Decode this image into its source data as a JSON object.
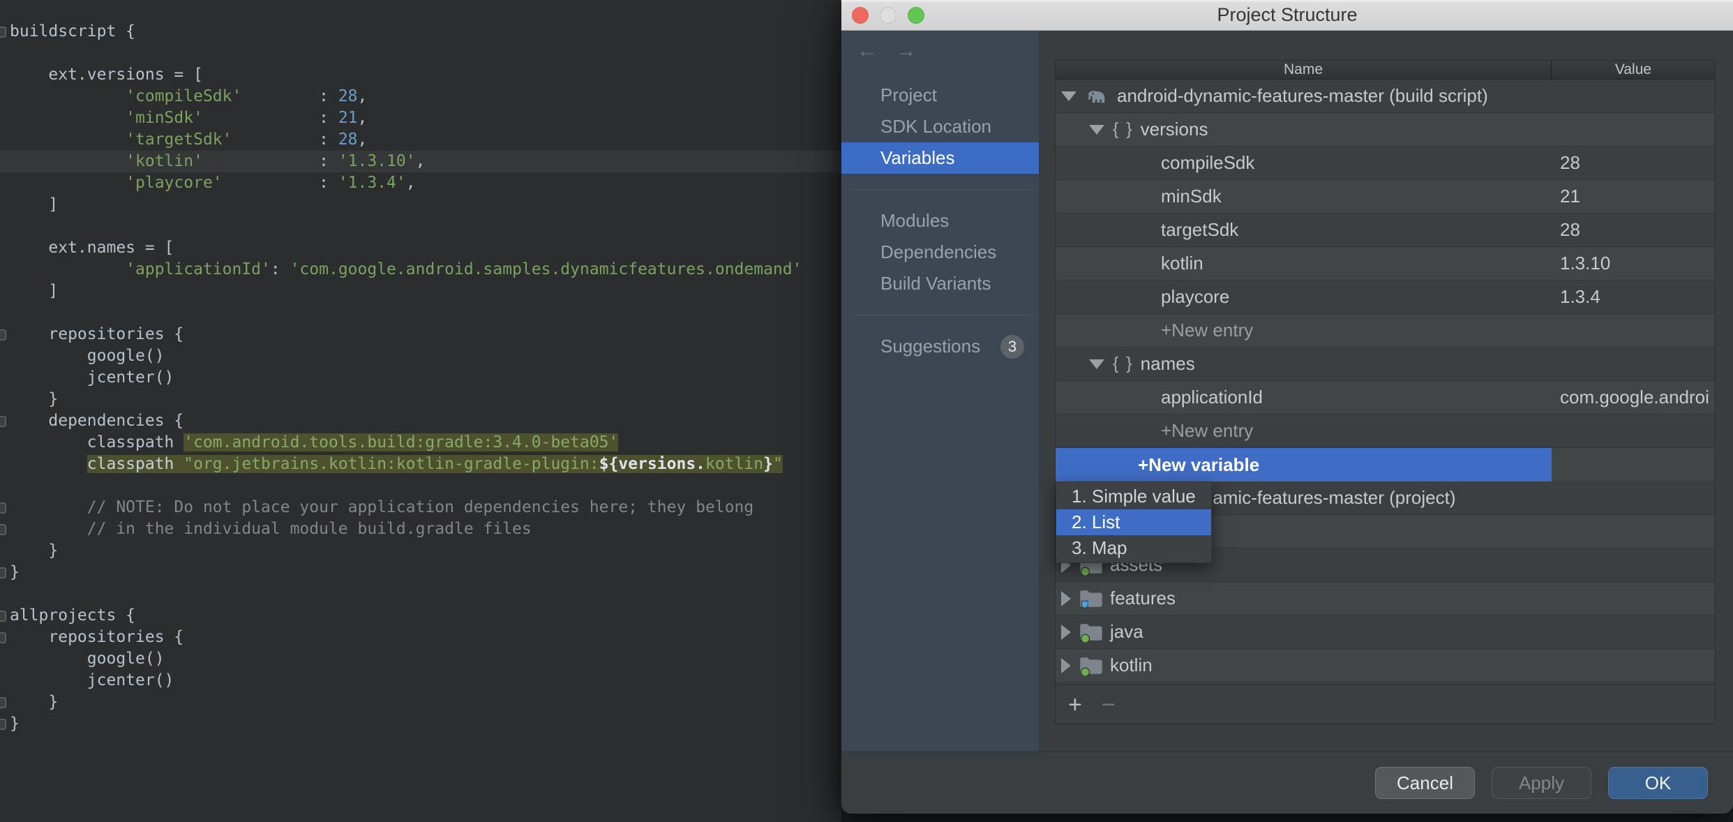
{
  "editor": {
    "lines": [
      {
        "mark": true,
        "segs": [
          [
            "p",
            "buildscript {"
          ]
        ]
      },
      {
        "segs": []
      },
      {
        "segs": [
          [
            "p",
            "    ext.versions = ["
          ]
        ]
      },
      {
        "segs": [
          [
            "s",
            "            'compileSdk'"
          ],
          [
            "p",
            "        : "
          ],
          [
            "n",
            "28"
          ],
          [
            "p",
            ","
          ]
        ]
      },
      {
        "segs": [
          [
            "s",
            "            'minSdk'"
          ],
          [
            "p",
            "            : "
          ],
          [
            "n",
            "21"
          ],
          [
            "p",
            ","
          ]
        ]
      },
      {
        "segs": [
          [
            "s",
            "            'targetSdk'"
          ],
          [
            "p",
            "         : "
          ],
          [
            "n",
            "28"
          ],
          [
            "p",
            ","
          ]
        ]
      },
      {
        "cur": true,
        "segs": [
          [
            "s",
            "            'kotlin'"
          ],
          [
            "p",
            "            : "
          ],
          [
            "s",
            "'1.3.10'"
          ],
          [
            "p",
            ","
          ]
        ]
      },
      {
        "segs": [
          [
            "s",
            "            'playcore'"
          ],
          [
            "p",
            "          : "
          ],
          [
            "s",
            "'1.3.4'"
          ],
          [
            "p",
            ","
          ]
        ]
      },
      {
        "segs": [
          [
            "p",
            "    ]"
          ]
        ]
      },
      {
        "segs": []
      },
      {
        "segs": [
          [
            "p",
            "    ext.names = ["
          ]
        ]
      },
      {
        "segs": [
          [
            "s",
            "            'applicationId'"
          ],
          [
            "p",
            ": "
          ],
          [
            "s",
            "'com.google.android.samples.dynamicfeatures.ondemand'"
          ]
        ]
      },
      {
        "segs": [
          [
            "p",
            "    ]"
          ]
        ]
      },
      {
        "segs": []
      },
      {
        "mark": true,
        "segs": [
          [
            "p",
            "    repositories {"
          ]
        ]
      },
      {
        "segs": [
          [
            "p",
            "        google()"
          ]
        ]
      },
      {
        "segs": [
          [
            "p",
            "        jcenter()"
          ]
        ]
      },
      {
        "segs": [
          [
            "p",
            "    }"
          ]
        ]
      },
      {
        "mark": true,
        "segs": [
          [
            "p",
            "    dependencies {"
          ]
        ]
      },
      {
        "segs": [
          [
            "p",
            "        classpath "
          ],
          [
            "sh",
            "'com.android.tools.build:gradle:3.4.0-beta05'"
          ]
        ]
      },
      {
        "segs": [
          [
            "p",
            "        "
          ],
          [
            "ph",
            "classpath "
          ],
          [
            "sh",
            "\"org.jetbrains.kotlin:kotlin-gradle-plugin:"
          ],
          [
            "wh",
            "${versions."
          ],
          [
            "sh",
            "kotlin"
          ],
          [
            "wh",
            "}"
          ],
          [
            "sh",
            "\""
          ]
        ]
      },
      {
        "segs": []
      },
      {
        "mark": true,
        "segs": [
          [
            "c",
            "        // NOTE: Do not place your application dependencies here; they belong"
          ]
        ]
      },
      {
        "mark": true,
        "segs": [
          [
            "c",
            "        // in the individual module build.gradle files"
          ]
        ]
      },
      {
        "segs": [
          [
            "p",
            "    }"
          ]
        ]
      },
      {
        "mark": true,
        "segs": [
          [
            "p",
            "}"
          ]
        ]
      },
      {
        "segs": []
      },
      {
        "mark": true,
        "segs": [
          [
            "p",
            "allprojects {"
          ]
        ]
      },
      {
        "mark": true,
        "segs": [
          [
            "p",
            "    repositories {"
          ]
        ]
      },
      {
        "segs": [
          [
            "p",
            "        google()"
          ]
        ]
      },
      {
        "segs": [
          [
            "p",
            "        jcenter()"
          ]
        ]
      },
      {
        "mark": true,
        "segs": [
          [
            "p",
            "    }"
          ]
        ]
      },
      {
        "mark": true,
        "segs": [
          [
            "p",
            "}"
          ]
        ]
      }
    ]
  },
  "dialog": {
    "title": "Project Structure",
    "window_controls": [
      "close",
      "minimize",
      "zoom"
    ],
    "nav": {
      "back_icon": "←",
      "forward_icon": "→"
    },
    "sidebar": {
      "items": [
        {
          "label": "Project"
        },
        {
          "label": "SDK Location"
        },
        {
          "label": "Variables",
          "selected": true
        },
        {
          "divider": true
        },
        {
          "label": "Modules"
        },
        {
          "label": "Dependencies"
        },
        {
          "label": "Build Variants"
        },
        {
          "divider": true
        },
        {
          "label": "Suggestions",
          "badge": "3"
        }
      ]
    },
    "table": {
      "columns": {
        "name": "Name",
        "value": "Value"
      },
      "rows": [
        {
          "level": 0,
          "arrow": "open",
          "icon": "gradle-elephant",
          "name": "android-dynamic-features-master (build script)",
          "value": ""
        },
        {
          "level": 1,
          "arrow": "open",
          "icon": "braces",
          "name": "versions",
          "value": ""
        },
        {
          "level": 2,
          "name": "compileSdk",
          "value": "28"
        },
        {
          "level": 2,
          "name": "minSdk",
          "value": "21"
        },
        {
          "level": 2,
          "name": "targetSdk",
          "value": "28"
        },
        {
          "level": 2,
          "name": "kotlin",
          "value": "1.3.10"
        },
        {
          "level": 2,
          "name": "playcore",
          "value": "1.3.4"
        },
        {
          "level": 2,
          "name": "+New entry",
          "value": "",
          "kind": "new"
        },
        {
          "level": 1,
          "arrow": "open",
          "icon": "braces",
          "name": "names",
          "value": ""
        },
        {
          "level": 2,
          "name": "applicationId",
          "value": "com.google.androi"
        },
        {
          "level": 2,
          "name": "+New entry",
          "value": "",
          "kind": "new"
        },
        {
          "level": 1,
          "name": "+New variable",
          "value": "",
          "kind": "selected"
        },
        {
          "level": 0,
          "arrow": "open",
          "icon": "gradle-elephant",
          "name": "android-dynamic-features-master (project)",
          "value": ""
        },
        {
          "level": 0,
          "name": "",
          "value": "",
          "kind": "empty"
        },
        {
          "level": 0,
          "arrow": "closed",
          "icon": "folder-green-dot",
          "name": "assets",
          "value": ""
        },
        {
          "level": 0,
          "arrow": "closed",
          "icon": "folder-java-cup",
          "name": "features",
          "value": ""
        },
        {
          "level": 0,
          "arrow": "closed",
          "icon": "folder-green-dot",
          "name": "java",
          "value": ""
        },
        {
          "level": 0,
          "arrow": "closed",
          "icon": "folder-green-dot",
          "name": "kotlin",
          "value": ""
        }
      ]
    },
    "popup": {
      "items": [
        {
          "label": "1. Simple value"
        },
        {
          "label": "2. List",
          "selected": true
        },
        {
          "label": "3. Map"
        }
      ]
    },
    "panel_toolbar": {
      "add": "+",
      "remove": "−"
    },
    "buttons": {
      "cancel": "Cancel",
      "apply": "Apply",
      "ok": "OK"
    }
  },
  "colors": {
    "accent_blue": "#3f6cc4",
    "sidebar_bg": "#3d4753",
    "dialog_bg": "#3a3d3f",
    "editor_bg": "#2b2d2e",
    "selection_olive": "#4e512d",
    "ok_button": "#38608e"
  }
}
